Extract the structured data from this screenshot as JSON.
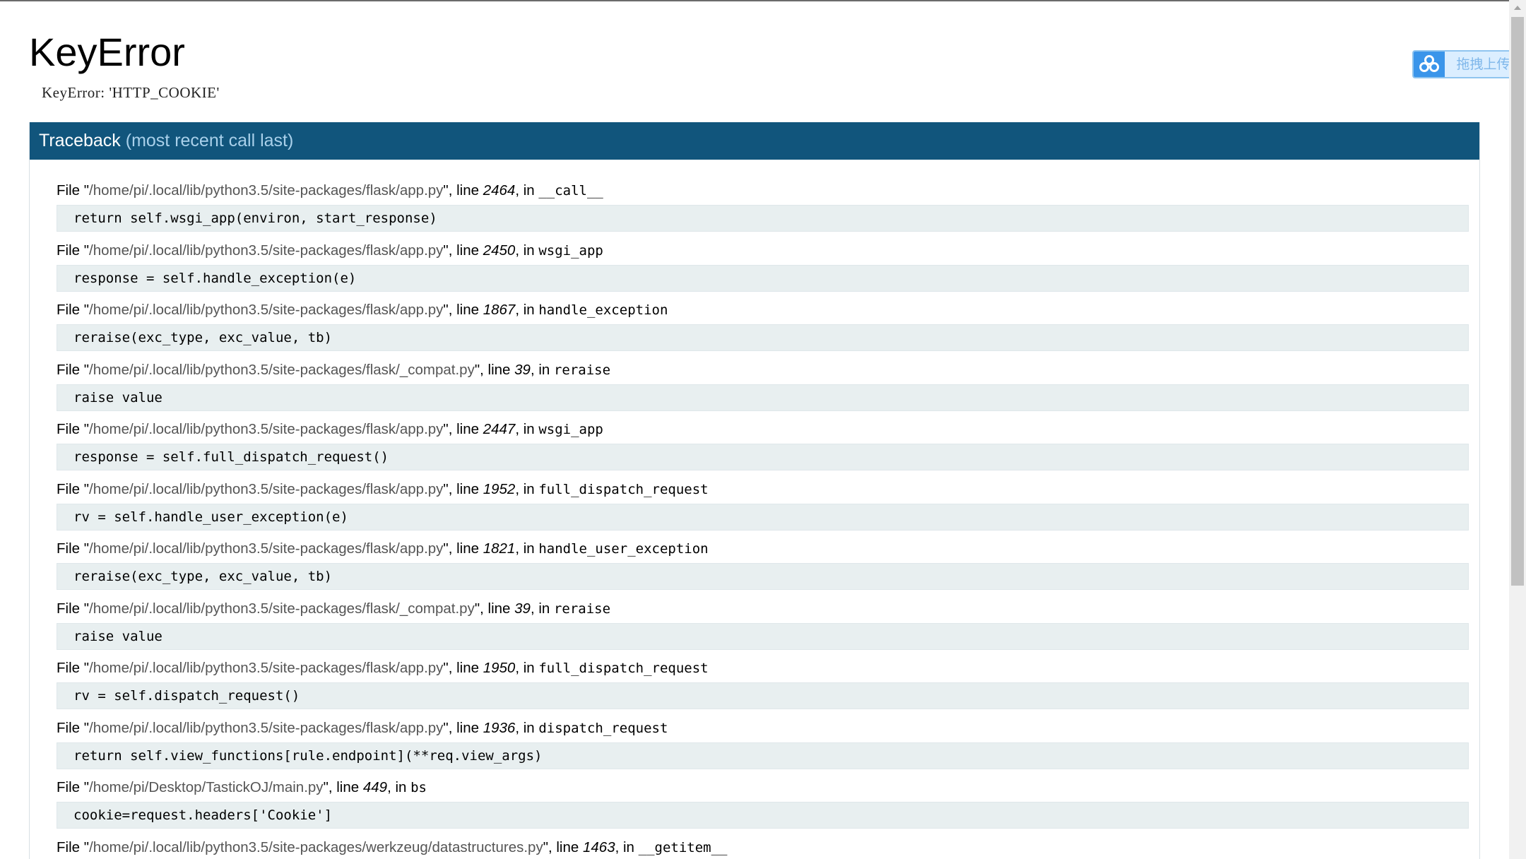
{
  "error": {
    "title": "KeyError",
    "message": "KeyError: 'HTTP_COOKIE'"
  },
  "traceback": {
    "header_label": "Traceback",
    "header_sub": "(most recent call last)",
    "frames": [
      {
        "path": "/home/pi/.local/lib/python3.5/site-packages/flask/app.py",
        "line": "2464",
        "func": "__call__",
        "code": "return self.wsgi_app(environ, start_response)"
      },
      {
        "path": "/home/pi/.local/lib/python3.5/site-packages/flask/app.py",
        "line": "2450",
        "func": "wsgi_app",
        "code": "response = self.handle_exception(e)"
      },
      {
        "path": "/home/pi/.local/lib/python3.5/site-packages/flask/app.py",
        "line": "1867",
        "func": "handle_exception",
        "code": "reraise(exc_type, exc_value, tb)"
      },
      {
        "path": "/home/pi/.local/lib/python3.5/site-packages/flask/_compat.py",
        "line": "39",
        "func": "reraise",
        "code": "raise value"
      },
      {
        "path": "/home/pi/.local/lib/python3.5/site-packages/flask/app.py",
        "line": "2447",
        "func": "wsgi_app",
        "code": "response = self.full_dispatch_request()"
      },
      {
        "path": "/home/pi/.local/lib/python3.5/site-packages/flask/app.py",
        "line": "1952",
        "func": "full_dispatch_request",
        "code": "rv = self.handle_user_exception(e)"
      },
      {
        "path": "/home/pi/.local/lib/python3.5/site-packages/flask/app.py",
        "line": "1821",
        "func": "handle_user_exception",
        "code": "reraise(exc_type, exc_value, tb)"
      },
      {
        "path": "/home/pi/.local/lib/python3.5/site-packages/flask/_compat.py",
        "line": "39",
        "func": "reraise",
        "code": "raise value"
      },
      {
        "path": "/home/pi/.local/lib/python3.5/site-packages/flask/app.py",
        "line": "1950",
        "func": "full_dispatch_request",
        "code": "rv = self.dispatch_request()"
      },
      {
        "path": "/home/pi/.local/lib/python3.5/site-packages/flask/app.py",
        "line": "1936",
        "func": "dispatch_request",
        "code": "return self.view_functions[rule.endpoint](**req.view_args)"
      },
      {
        "path": "/home/pi/Desktop/TastickOJ/main.py",
        "line": "449",
        "func": "bs",
        "code": "cookie=request.headers['Cookie']"
      },
      {
        "path": "/home/pi/.local/lib/python3.5/site-packages/werkzeug/datastructures.py",
        "line": "1463",
        "func": "__getitem__",
        "code": ""
      }
    ]
  },
  "strings": {
    "file_word": "File ",
    "quote": "\"",
    "line_word": ", line ",
    "in_word": ", in "
  },
  "upload_widget": {
    "label": "拖拽上传",
    "icon": "baidu-cloud-icon"
  }
}
